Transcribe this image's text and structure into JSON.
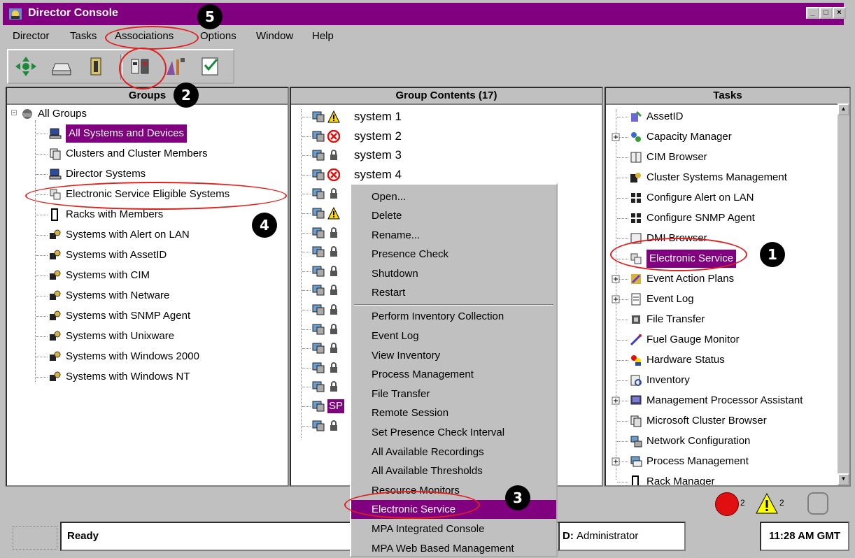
{
  "window": {
    "title": "Director Console",
    "min": "_",
    "max": "□",
    "close": "×"
  },
  "menubar": [
    "Director",
    "Tasks",
    "Associations",
    "Options",
    "Window",
    "Help"
  ],
  "groups_panel": {
    "header": "Groups",
    "root": "All Groups",
    "items": [
      "All Systems and Devices",
      "Clusters and Cluster Members",
      "Director Systems",
      "Electronic Service Eligible Systems",
      "Racks with Members",
      "Systems with Alert on LAN",
      "Systems with AssetID",
      "Systems with CIM",
      "Systems with Netware",
      "Systems with SNMP Agent",
      "Systems with Unixware",
      "Systems with Windows 2000",
      "Systems with Windows NT"
    ]
  },
  "contents_panel": {
    "header": "Group Contents (17)",
    "systems": [
      "system 1",
      "system 2",
      "system 3",
      "system 4"
    ],
    "sp_label": "SP"
  },
  "tasks_panel": {
    "header": "Tasks",
    "items": [
      "AssetID",
      "Capacity Manager",
      "CIM Browser",
      "Cluster Systems Management",
      "Configure Alert on LAN",
      "Configure SNMP Agent",
      "DMI Browser",
      "Electronic Service",
      "Event Action Plans",
      "Event Log",
      "File Transfer",
      "Fuel Gauge Monitor",
      "Hardware Status",
      "Inventory",
      "Management Processor Assistant",
      "Microsoft Cluster Browser",
      "Network Configuration",
      "Process Management",
      "Rack Manager"
    ]
  },
  "context_menu": {
    "group1": [
      "Open...",
      "Delete",
      "Rename...",
      "Presence Check",
      "Shutdown",
      "Restart"
    ],
    "group2": [
      "Perform Inventory Collection",
      "Event Log",
      "View Inventory",
      "Process Management",
      "File Transfer",
      "Remote Session",
      "Set Presence Check Interval",
      "All Available Recordings",
      "All Available Thresholds",
      "Resource Monitors",
      "Electronic Service",
      "MPA Integrated Console",
      "MPA Web Based Management"
    ]
  },
  "alerts": {
    "critical_count": "2",
    "warning_count": "2"
  },
  "statusbar": {
    "status": "Ready",
    "user_label": "D:",
    "user": "Administrator",
    "time": "11:28 AM GMT"
  },
  "annotations": {
    "one": "1",
    "two": "2",
    "three": "3",
    "four": "4",
    "five": "5"
  },
  "colors": {
    "selection": "#800080",
    "annotation": "#e0201c",
    "background": "#c0c0c0"
  }
}
